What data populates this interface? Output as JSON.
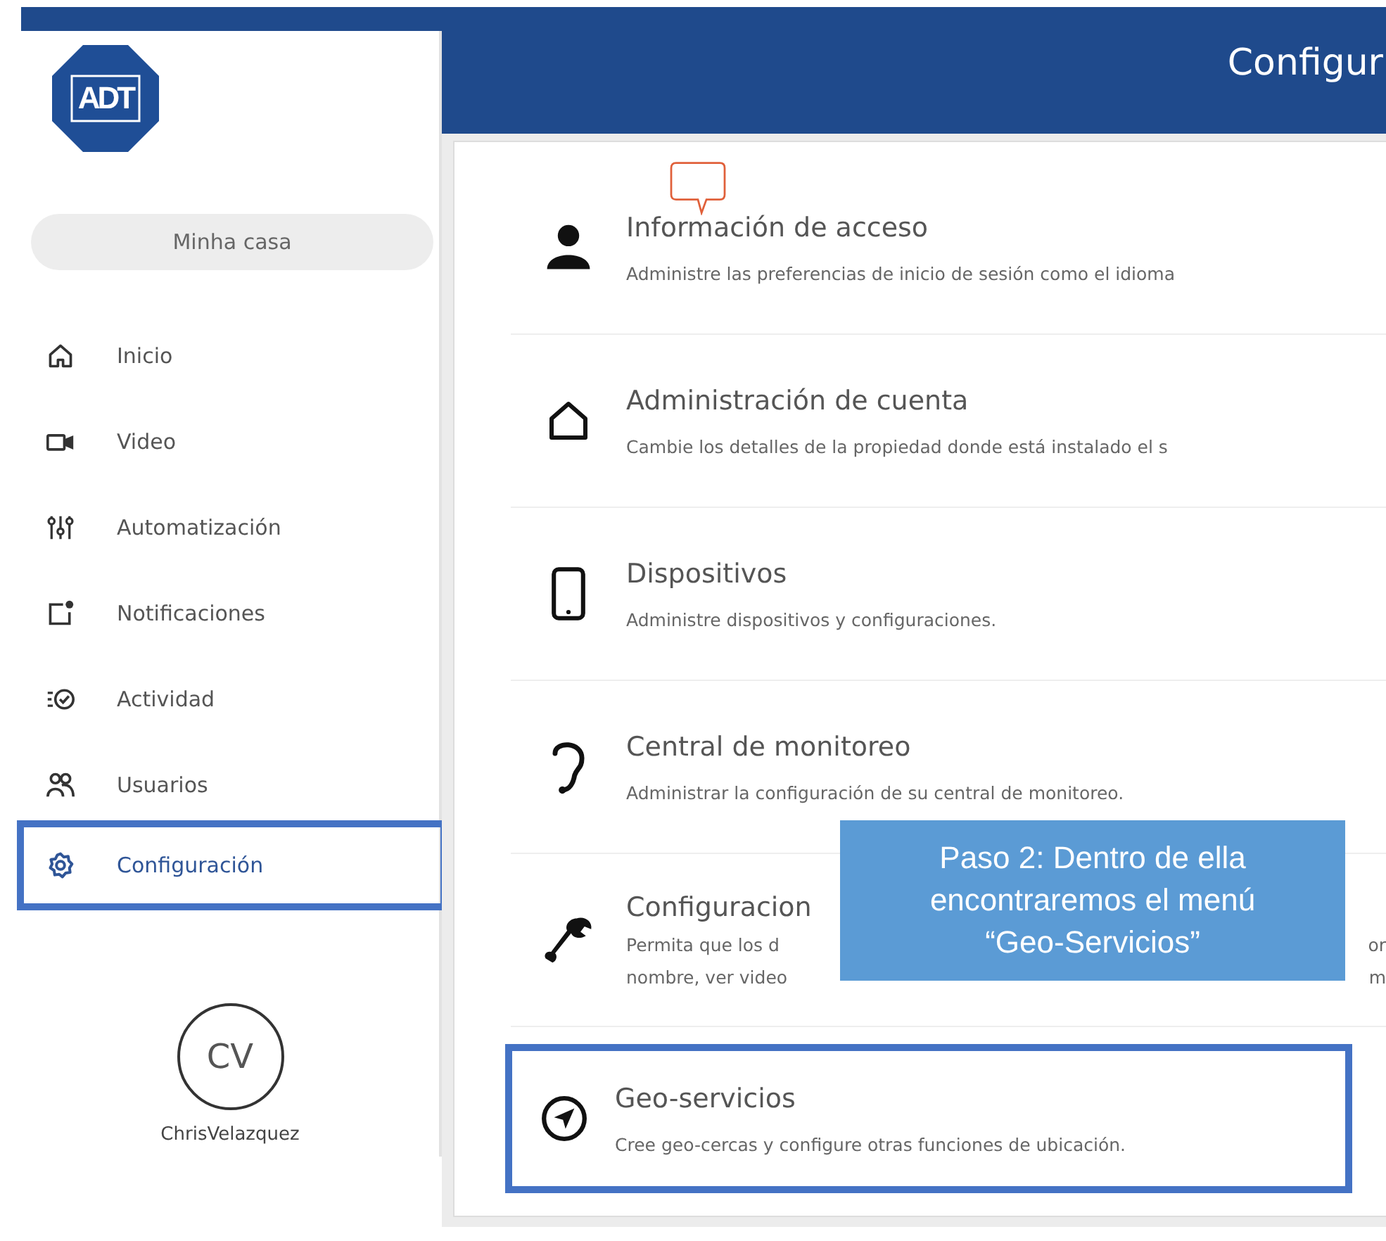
{
  "header": {
    "title": "Configur"
  },
  "logo": {
    "text": "ADT"
  },
  "home_selector": {
    "label": "Minha casa"
  },
  "nav": [
    {
      "label": "Inicio",
      "selected": false,
      "outlined": false
    },
    {
      "label": "Video",
      "selected": false,
      "outlined": false
    },
    {
      "label": "Automatización",
      "selected": false,
      "outlined": false
    },
    {
      "label": "Notificaciones",
      "selected": false,
      "outlined": false
    },
    {
      "label": "Actividad",
      "selected": false,
      "outlined": false
    },
    {
      "label": "Usuarios",
      "selected": false,
      "outlined": false
    },
    {
      "label": "Configuración",
      "selected": true,
      "outlined": true
    }
  ],
  "user": {
    "initials": "CV",
    "name": "ChrisVelazquez"
  },
  "settings": [
    {
      "title": "Información de acceso",
      "description": "Administre las preferencias de inicio de sesión como el idioma",
      "outlined": false,
      "comment": true
    },
    {
      "title": "Administración de cuenta",
      "description": "Cambie los detalles de la propiedad donde está instalado el s",
      "outlined": false,
      "comment": false
    },
    {
      "title": "Dispositivos",
      "description": "Administre dispositivos y configuraciones.",
      "outlined": false,
      "comment": false
    },
    {
      "title": "Central de monitoreo",
      "description": "Administrar la configuración de su central de monitoreo.",
      "outlined": false,
      "comment": false
    },
    {
      "title": "Configuracion",
      "description_lines": [
        {
          "left": "Permita que los d",
          "right": "or"
        },
        {
          "left": "nombre, ver video",
          "right": "m"
        }
      ],
      "outlined": false,
      "comment": false
    },
    {
      "title": "Geo-servicios",
      "description": "Cree geo-cercas y configure otras funciones de ubicación.",
      "outlined": true,
      "comment": false
    }
  ],
  "callout": {
    "text": "Paso 2: Dentro de ella encontraremos el menú “Geo-Servicios”"
  }
}
